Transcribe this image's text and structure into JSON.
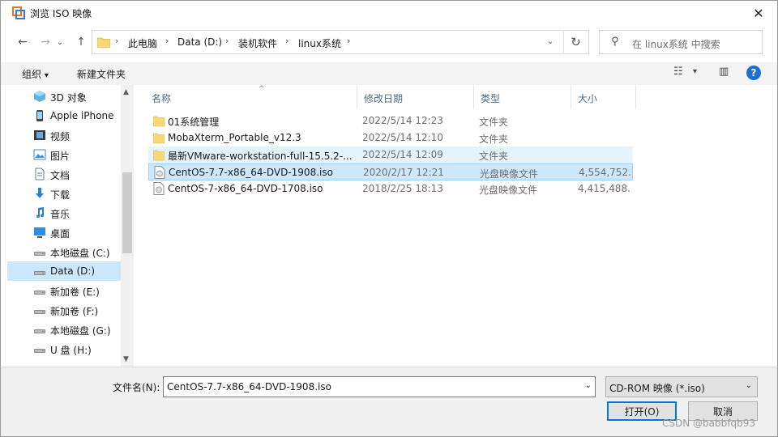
{
  "window": {
    "title": "浏览 ISO 映像",
    "close_glyph": "✕"
  },
  "nav": {
    "back_glyph": "←",
    "forward_glyph": "→",
    "dropdown_glyph": "⌄",
    "up_glyph": "↑",
    "breadcrumbs": [
      "此电脑",
      "装机软件",
      "linux系统"
    ],
    "breadcrumb_drive": "Data (D:)",
    "crumb_sep": "›",
    "refresh_glyph": "↻",
    "addr_dropdown_glyph": "⌄",
    "search_placeholder": "在 linux系统 中搜索",
    "search_glyph": "⚲"
  },
  "toolbar": {
    "organize_label": "组织",
    "organize_caret": "▾",
    "new_folder_label": "新建文件夹",
    "view_glyph": "☷",
    "view_caret": "▾",
    "pane_glyph": "▥",
    "help_glyph": "?"
  },
  "sidebar": {
    "items": [
      {
        "label": "3D 对象",
        "icon": "3d-objects-icon",
        "selected": false
      },
      {
        "label": "Apple iPhone",
        "icon": "phone-icon",
        "selected": false
      },
      {
        "label": "视频",
        "icon": "video-icon",
        "selected": false
      },
      {
        "label": "图片",
        "icon": "pictures-icon",
        "selected": false
      },
      {
        "label": "文档",
        "icon": "documents-icon",
        "selected": false
      },
      {
        "label": "下载",
        "icon": "downloads-icon",
        "selected": false
      },
      {
        "label": "音乐",
        "icon": "music-icon",
        "selected": false
      },
      {
        "label": "桌面",
        "icon": "desktop-icon",
        "selected": false
      },
      {
        "label": "本地磁盘 (C:)",
        "icon": "drive-icon",
        "selected": false
      },
      {
        "label": "Data (D:)",
        "icon": "drive-icon",
        "selected": true
      },
      {
        "label": "新加卷 (E:)",
        "icon": "drive-icon",
        "selected": false
      },
      {
        "label": "新加卷 (F:)",
        "icon": "drive-icon",
        "selected": false
      },
      {
        "label": "本地磁盘 (G:)",
        "icon": "drive-icon",
        "selected": false
      },
      {
        "label": "U 盘 (H:)",
        "icon": "drive-icon",
        "selected": false
      }
    ],
    "scroll_up": "▲",
    "scroll_down": "▼"
  },
  "filelist": {
    "columns": [
      "名称",
      "修改日期",
      "类型",
      "大小"
    ],
    "sort_caret": "^",
    "rows": [
      {
        "name": "01系统管理",
        "date": "2022/5/14 12:23",
        "type": "文件夹",
        "size": "",
        "kind": "folder",
        "state": "normal"
      },
      {
        "name": "MobaXterm_Portable_v12.3",
        "date": "2022/5/14 12:10",
        "type": "文件夹",
        "size": "",
        "kind": "folder",
        "state": "normal"
      },
      {
        "name": "最新VMware-workstation-full-15.5.2-...",
        "date": "2022/5/14 12:09",
        "type": "文件夹",
        "size": "",
        "kind": "folder",
        "state": "hovered"
      },
      {
        "name": "CentOS-7.7-x86_64-DVD-1908.iso",
        "date": "2020/2/17 12:21",
        "type": "光盘映像文件",
        "size": "4,554,752...",
        "kind": "iso",
        "state": "selected"
      },
      {
        "name": "CentOS-7-x86_64-DVD-1708.iso",
        "date": "2018/2/25 18:13",
        "type": "光盘映像文件",
        "size": "4,415,488...",
        "kind": "iso",
        "state": "normal"
      }
    ]
  },
  "bottom": {
    "filename_label": "文件名(N):",
    "filename_value": "CentOS-7.7-x86_64-DVD-1908.iso",
    "filename_dd": "⌄",
    "filter_value": "CD-ROM 映像 (*.iso)",
    "filter_dd": "⌄",
    "open_label": "打开(O)",
    "cancel_label": "取消",
    "watermark": "CSDN @babbfqb93"
  },
  "colors": {
    "accent": "#0078d7",
    "selection": "#cce8ff",
    "hover": "#e5f3ff",
    "folder": "#f8d775"
  }
}
